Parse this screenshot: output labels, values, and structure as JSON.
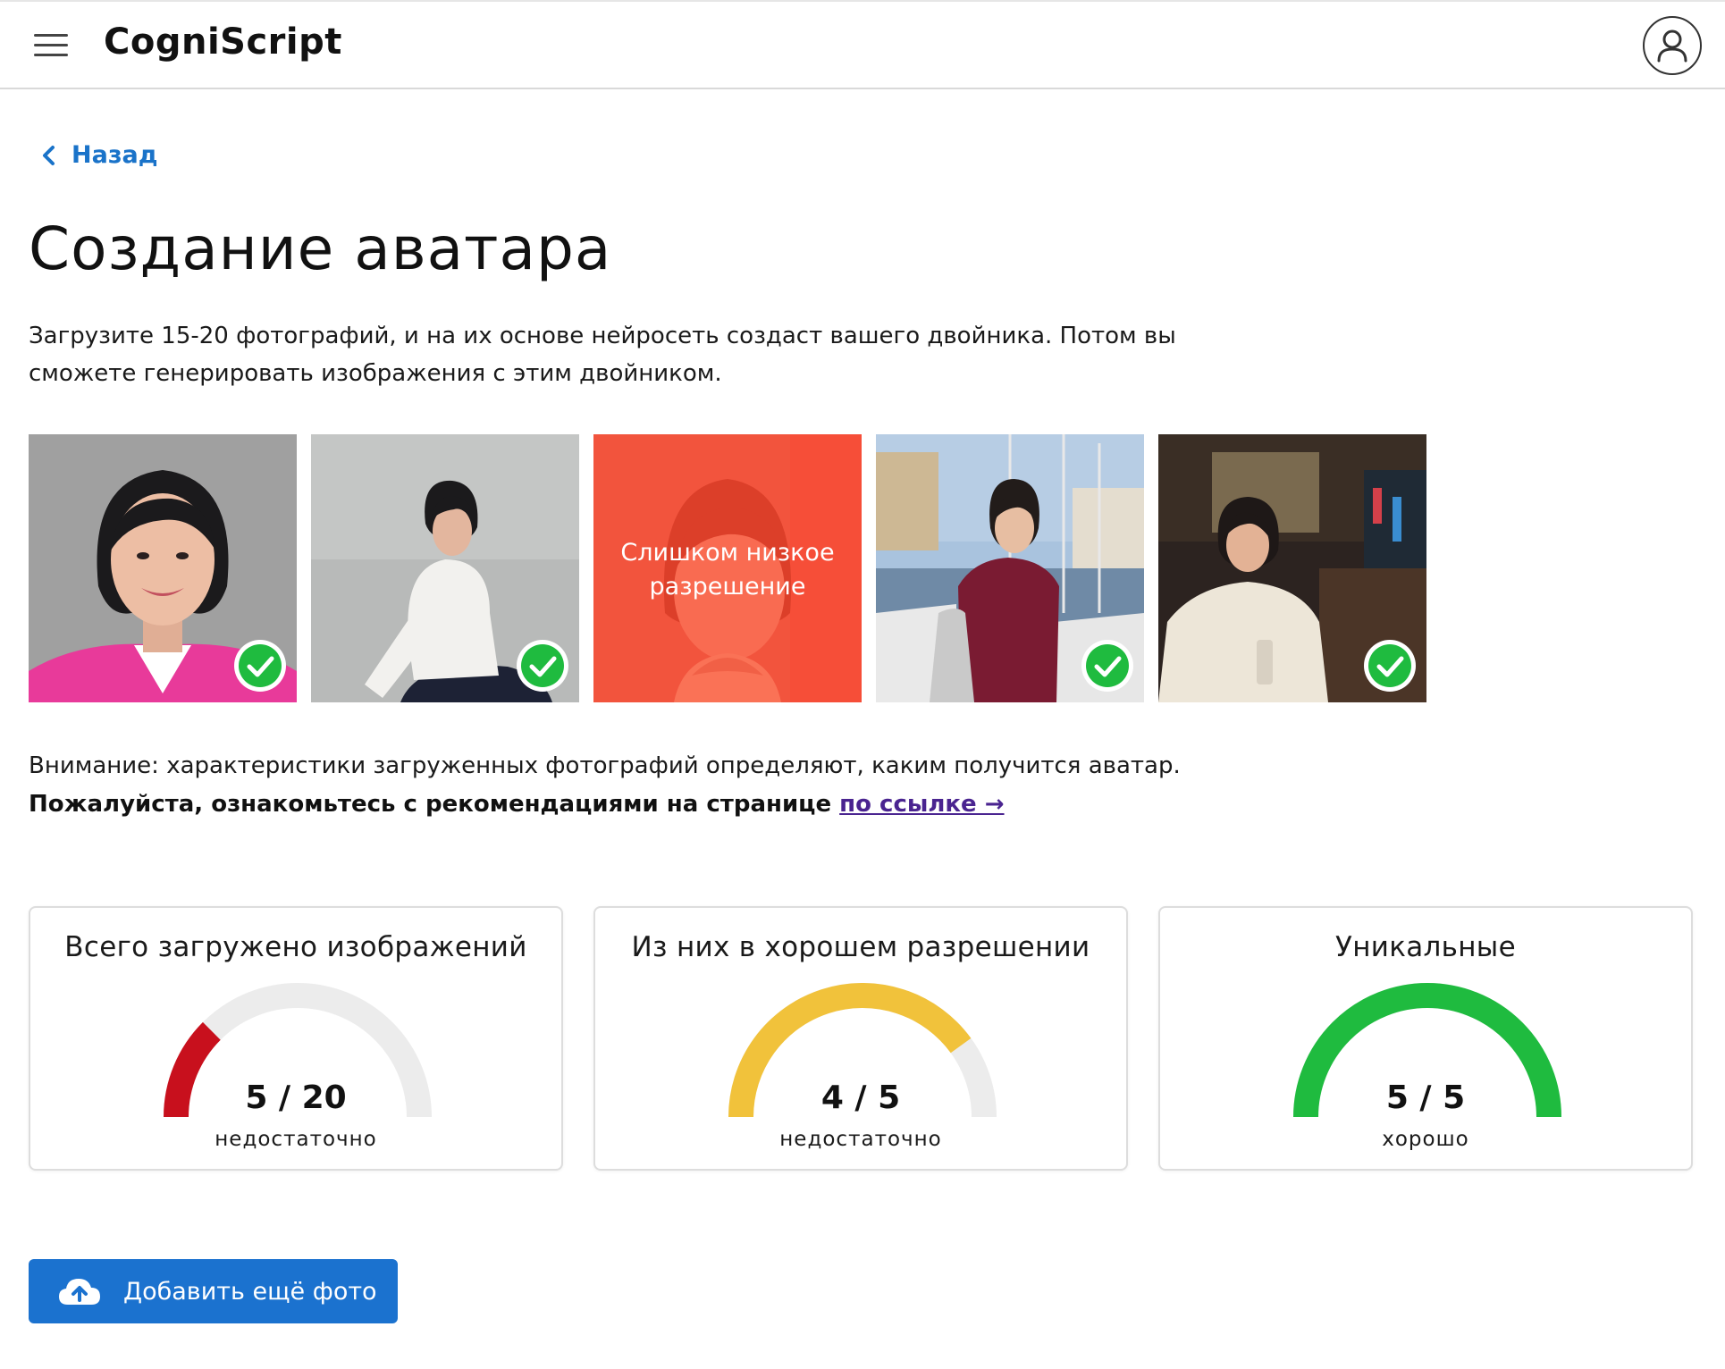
{
  "header": {
    "app_title": "CogniScript",
    "menu_icon": "hamburger-menu-icon",
    "user_icon": "user-account-icon"
  },
  "nav": {
    "back_label": "Назад"
  },
  "page": {
    "title": "Создание аватара",
    "intro_line1": "Загрузите 15-20 фотографий, и на их основе нейросеть создаст вашего двойника. Потом вы",
    "intro_line2": "сможете генерировать изображения с этим двойником."
  },
  "photos": [
    {
      "status": "ok",
      "icon": "check-circle-icon"
    },
    {
      "status": "ok",
      "icon": "check-circle-icon"
    },
    {
      "status": "rejected",
      "overlay_text": "Слишком низкое разрешение"
    },
    {
      "status": "ok",
      "icon": "check-circle-icon"
    },
    {
      "status": "ok",
      "icon": "check-circle-icon"
    }
  ],
  "notice": {
    "line1": "Внимание: характеристики загруженных фотографий определяют, каким получится аватар.",
    "line2_bold": "Пожалуйста, ознакомьтесь с рекомендациями на странице ",
    "link_text": "по ссылке →"
  },
  "stats": [
    {
      "title": "Всего загружено изображений",
      "value_text": "5 / 20",
      "current": 5,
      "total": 20,
      "status": "недостаточно",
      "color": "#c8101d"
    },
    {
      "title": "Из них в хорошем разрешении",
      "value_text": "4 / 5",
      "current": 4,
      "total": 5,
      "status": "недостаточно",
      "color": "#f1c23b"
    },
    {
      "title": "Уникальные",
      "value_text": "5 / 5",
      "current": 5,
      "total": 5,
      "status": "хорошо",
      "color": "#1fbb3f"
    }
  ],
  "gauge_track_color": "#ececec",
  "actions": {
    "add_photo_label": "Добавить ещё фото",
    "add_photo_icon": "cloud-upload-icon"
  },
  "colors": {
    "accent": "#1b72cf",
    "link": "#4a2490",
    "check": "#1fbb3f"
  }
}
